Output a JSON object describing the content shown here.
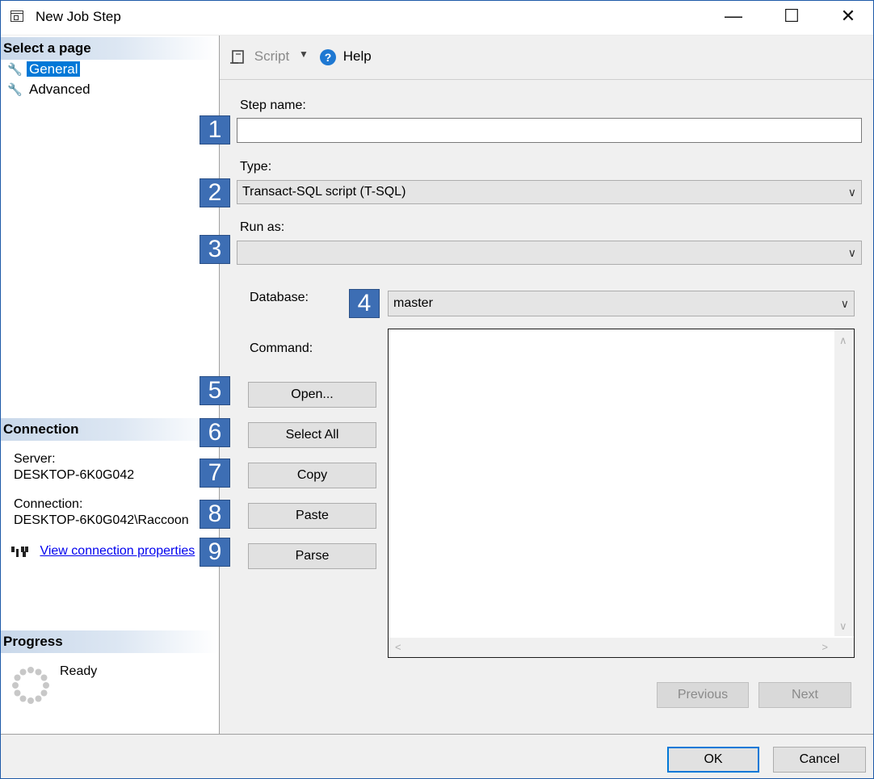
{
  "window": {
    "title": "New Job Step",
    "minimize": "—",
    "maximize": "☐",
    "close": "✕"
  },
  "left_panel": {
    "select_page_header": "Select a page",
    "pages": [
      {
        "label": "General",
        "selected": true
      },
      {
        "label": "Advanced",
        "selected": false
      }
    ],
    "connection_header": "Connection",
    "server_label": "Server:",
    "server_value": "DESKTOP-6K0G042",
    "connection_label": "Connection:",
    "connection_value": "DESKTOP-6K0G042\\Raccoon",
    "view_connection_link": "View connection properties",
    "progress_header": "Progress",
    "progress_status": "Ready"
  },
  "toolbar": {
    "script_label": "Script",
    "help_label": "Help"
  },
  "form": {
    "step_name_label": "Step name:",
    "step_name_value": "",
    "type_label": "Type:",
    "type_value": "Transact-SQL script (T-SQL)",
    "run_as_label": "Run as:",
    "run_as_value": "",
    "database_label": "Database:",
    "database_value": "master",
    "command_label": "Command:",
    "buttons": {
      "open": "Open...",
      "select_all": "Select All",
      "copy": "Copy",
      "paste": "Paste",
      "parse": "Parse"
    },
    "previous_label": "Previous",
    "next_label": "Next"
  },
  "footer": {
    "ok_label": "OK",
    "cancel_label": "Cancel"
  },
  "callouts": [
    "1",
    "2",
    "3",
    "4",
    "5",
    "6",
    "7",
    "8",
    "9"
  ],
  "colors": {
    "accent": "#0078d7",
    "callout": "#3d6eb4",
    "link": "#0000ee"
  }
}
